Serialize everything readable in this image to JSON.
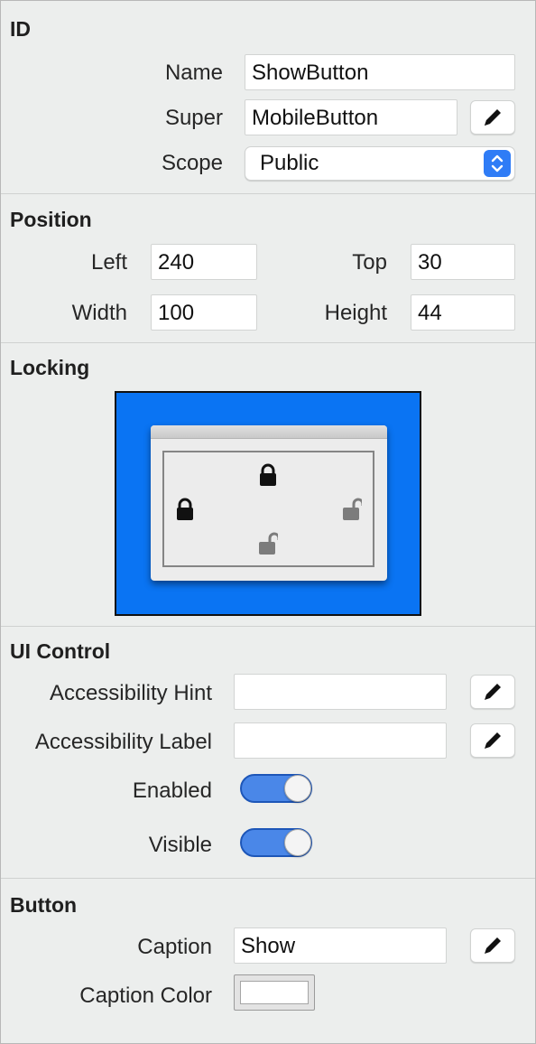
{
  "id_section": {
    "title": "ID",
    "name_label": "Name",
    "name_value": "ShowButton",
    "super_label": "Super",
    "super_value": "MobileButton",
    "scope_label": "Scope",
    "scope_value": "Public"
  },
  "position_section": {
    "title": "Position",
    "left_label": "Left",
    "left_value": "240",
    "top_label": "Top",
    "top_value": "30",
    "width_label": "Width",
    "width_value": "100",
    "height_label": "Height",
    "height_value": "44"
  },
  "locking_section": {
    "title": "Locking",
    "canvas_color": "#0a74f3",
    "locks": {
      "top": "locked",
      "left": "locked",
      "right": "unlocked",
      "bottom": "unlocked"
    }
  },
  "ui_control_section": {
    "title": "UI Control",
    "accessibility_hint_label": "Accessibility Hint",
    "accessibility_hint_value": "",
    "accessibility_label_label": "Accessibility Label",
    "accessibility_label_value": "",
    "enabled_label": "Enabled",
    "enabled_value": true,
    "visible_label": "Visible",
    "visible_value": true,
    "toggle_color": "#4a87e8"
  },
  "button_section": {
    "title": "Button",
    "caption_label": "Caption",
    "caption_value": "Show",
    "caption_color_label": "Caption Color",
    "caption_color_value": "#ffffff"
  },
  "icons": {
    "edit": "pencil-icon",
    "popup": "chevron-up-down-icon",
    "lock_closed": "lock-closed-icon",
    "lock_open": "lock-open-icon"
  }
}
